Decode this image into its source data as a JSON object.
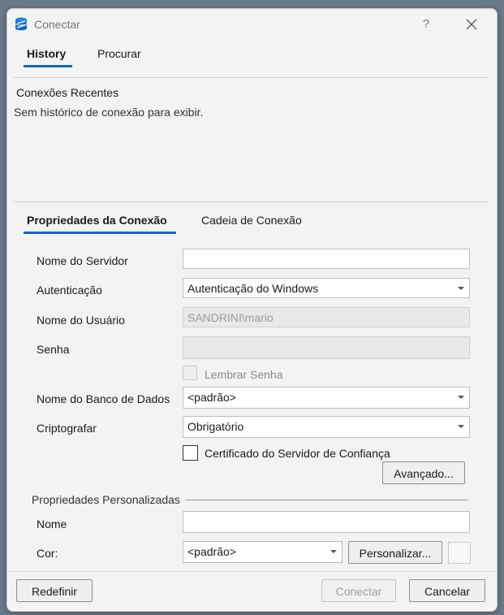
{
  "window": {
    "title": "Conectar",
    "help_label": "?"
  },
  "top_tabs": [
    {
      "label": "History",
      "active": true
    },
    {
      "label": "Procurar",
      "active": false
    }
  ],
  "history": {
    "title": "Conexões Recentes",
    "empty_message": "Sem histórico de conexão para exibir."
  },
  "connection_tabs": [
    {
      "label": "Propriedades da Conexão",
      "active": true
    },
    {
      "label": "Cadeia de Conexão",
      "active": false
    }
  ],
  "form": {
    "server_name": {
      "label": "Nome do Servidor",
      "value": ""
    },
    "authentication": {
      "label": "Autenticação",
      "value": "Autenticação do Windows"
    },
    "user_name": {
      "label": "Nome do Usuário",
      "value": "SANDRINI\\mario"
    },
    "password": {
      "label": "Senha",
      "value": ""
    },
    "remember_password": {
      "label": "Lembrar Senha",
      "checked": false
    },
    "database_name": {
      "label": "Nome do Banco de Dados",
      "value": "<padrão>"
    },
    "encrypt": {
      "label": "Criptografar",
      "value": "Obrigatório"
    },
    "trust_server_cert": {
      "label": "Certificado do Servidor de Confiança",
      "checked": false
    },
    "advanced_button": "Avançado..."
  },
  "custom_properties": {
    "section_title": "Propriedades Personalizadas",
    "name": {
      "label": "Nome",
      "value": ""
    },
    "color": {
      "label": "Cor:",
      "value": "<padrão>"
    },
    "customize_button": "Personalizar..."
  },
  "footer": {
    "reset_button": "Redefinir",
    "connect_button": "Conectar",
    "cancel_button": "Cancelar"
  },
  "colors": {
    "accent": "#1565c0",
    "app_icon": "#1e88e5"
  }
}
